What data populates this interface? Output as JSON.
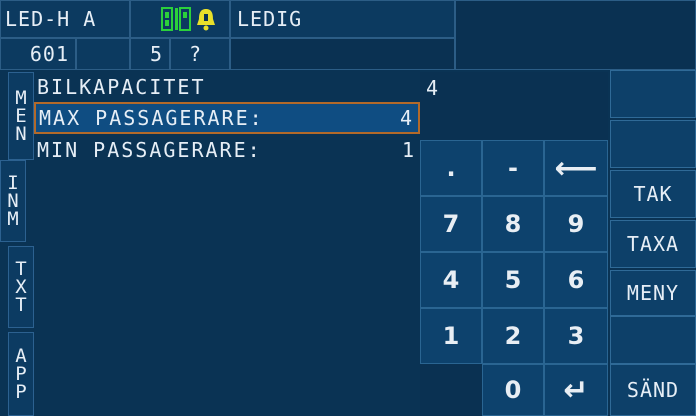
{
  "header": {
    "vehicle": "LED-H A",
    "status": "LEDIG",
    "car_number": "601",
    "field_blank": "",
    "count": "5",
    "question": "?"
  },
  "side_tabs": [
    {
      "label": "MEN",
      "letters": [
        "M",
        "E",
        "N"
      ]
    },
    {
      "label": "INM",
      "letters": [
        "I",
        "N",
        "M"
      ]
    },
    {
      "label": "TXT",
      "letters": [
        "T",
        "X",
        "T"
      ]
    },
    {
      "label": "APP",
      "letters": [
        "A",
        "P",
        "P"
      ]
    }
  ],
  "list": {
    "heading": "BILKAPACITET",
    "items": [
      {
        "label": "MAX PASSAGERARE:",
        "value": "4",
        "selected": true
      },
      {
        "label": "MIN PASSAGERARE:",
        "value": "1",
        "selected": false
      }
    ]
  },
  "input": {
    "value": "4"
  },
  "keypad": {
    "row1": [
      ".",
      "-",
      "⟵"
    ],
    "row2": [
      "7",
      "8",
      "9"
    ],
    "row3": [
      "4",
      "5",
      "6"
    ],
    "row4": [
      "1",
      "2",
      "3"
    ],
    "row5": [
      "",
      "0",
      "↵"
    ]
  },
  "function_keys": {
    "f1": "",
    "f2": "",
    "tak": "TAK",
    "taxa": "TAXA",
    "meny": "MENY",
    "f6": "",
    "sand": "SÄND"
  },
  "colors": {
    "background": "#0a3354",
    "selection": "#0f4d82",
    "selection_border": "#b36a2a",
    "meter_green": "#2bd13b",
    "bell_yellow": "#e8e02a"
  }
}
